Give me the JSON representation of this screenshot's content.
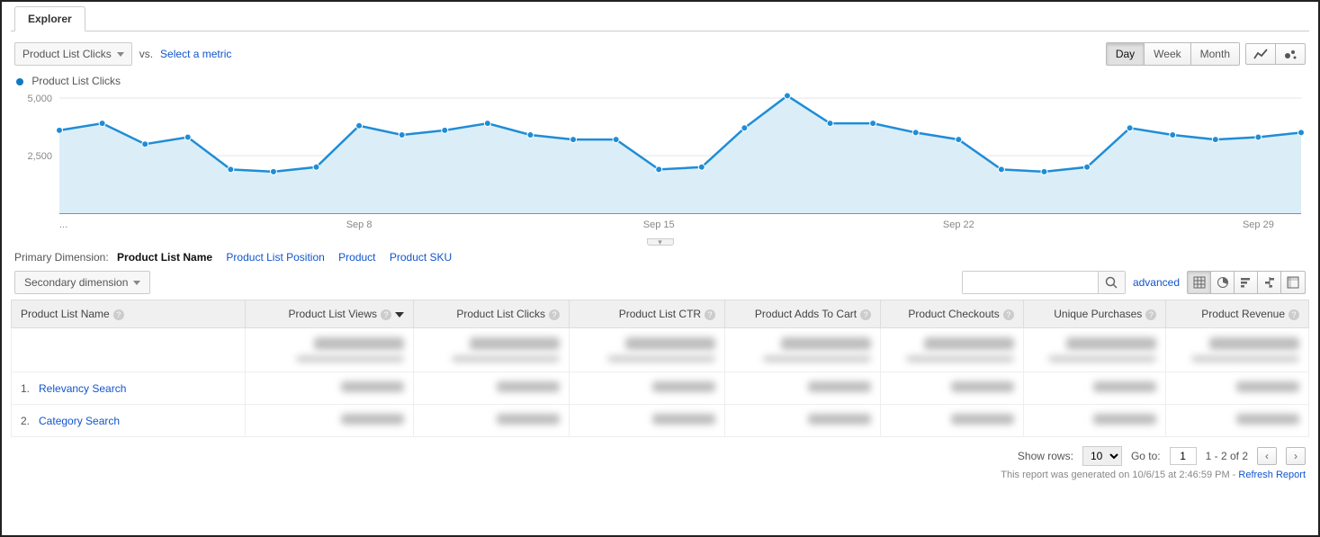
{
  "tab": {
    "label": "Explorer"
  },
  "toolbar": {
    "metric_primary": "Product List Clicks",
    "vs_label": "vs.",
    "select_metric": "Select a metric",
    "granularity": {
      "day": "Day",
      "week": "Week",
      "month": "Month",
      "active": "Day"
    }
  },
  "legend": {
    "series1": "Product List Clicks"
  },
  "chart": {
    "y_ticks": [
      "5,000",
      "2,500"
    ],
    "x_ticks": [
      "...",
      "Sep 8",
      "Sep 15",
      "Sep 22",
      "Sep 29"
    ]
  },
  "chart_data": {
    "type": "area",
    "title": "Product List Clicks",
    "ylabel": "",
    "xlabel": "",
    "ylim": [
      0,
      5000
    ],
    "x": [
      "Sep 1",
      "Sep 2",
      "Sep 3",
      "Sep 4",
      "Sep 5",
      "Sep 6",
      "Sep 7",
      "Sep 8",
      "Sep 9",
      "Sep 10",
      "Sep 11",
      "Sep 12",
      "Sep 13",
      "Sep 14",
      "Sep 15",
      "Sep 16",
      "Sep 17",
      "Sep 18",
      "Sep 19",
      "Sep 20",
      "Sep 21",
      "Sep 22",
      "Sep 23",
      "Sep 24",
      "Sep 25",
      "Sep 26",
      "Sep 27",
      "Sep 28",
      "Sep 29",
      "Sep 30"
    ],
    "series": [
      {
        "name": "Product List Clicks",
        "values": [
          3600,
          3900,
          3000,
          3300,
          1900,
          1800,
          2000,
          3800,
          3400,
          3600,
          3900,
          3400,
          3200,
          3200,
          1900,
          2000,
          3700,
          5100,
          3900,
          3900,
          3500,
          3200,
          1900,
          1800,
          2000,
          3700,
          3400,
          3200,
          3300,
          3500
        ]
      }
    ]
  },
  "dimensions": {
    "label": "Primary Dimension:",
    "selected": "Product List Name",
    "others": [
      "Product List Position",
      "Product",
      "Product SKU"
    ]
  },
  "secondary_dimension_label": "Secondary dimension",
  "search": {
    "placeholder": "",
    "advanced": "advanced"
  },
  "table": {
    "columns": [
      "Product List Name",
      "Product List Views",
      "Product List Clicks",
      "Product List CTR",
      "Product Adds To Cart",
      "Product Checkouts",
      "Unique Purchases",
      "Product Revenue"
    ],
    "sort_col": "Product List Views",
    "rows": [
      {
        "idx": "1.",
        "name": "Relevancy Search"
      },
      {
        "idx": "2.",
        "name": "Category Search"
      }
    ]
  },
  "footer": {
    "show_rows_label": "Show rows:",
    "show_rows_value": "10",
    "goto_label": "Go to:",
    "goto_value": "1",
    "range_text": "1 - 2 of 2",
    "generated_prefix": "This report was generated on 10/6/15 at 2:46:59 PM - ",
    "refresh": "Refresh Report"
  }
}
